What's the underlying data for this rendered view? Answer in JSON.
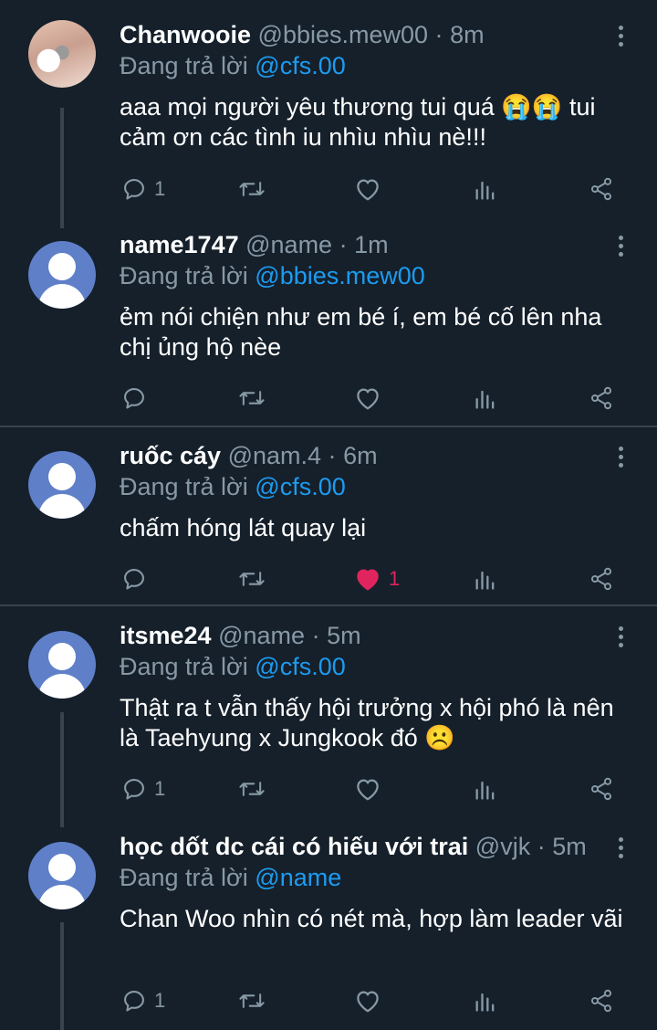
{
  "tweets": [
    {
      "name": "Chanwooie",
      "handle": "@bbies.mew00",
      "time": "8m",
      "reply_prefix": "Đang trả lời",
      "reply_to": "@cfs.00",
      "text": "aaa mọi người yêu thương tui quá 😭😭 tui cảm ơn các tình iu nhìu nhìu nè!!!",
      "reply_count": "1",
      "like_count": "",
      "liked": false
    },
    {
      "name": "name1747",
      "handle": "@name",
      "time": "1m",
      "reply_prefix": "Đang trả lời",
      "reply_to": "@bbies.mew00",
      "text": "ẻm nói chiện như em bé í, em bé cố lên nha chị ủng hộ nèe",
      "reply_count": "",
      "like_count": "",
      "liked": false
    },
    {
      "name": "ruốc cáy",
      "handle": "@nam.4",
      "time": "6m",
      "reply_prefix": "Đang trả lời",
      "reply_to": "@cfs.00",
      "text": "chấm hóng lát quay lại",
      "reply_count": "",
      "like_count": "1",
      "liked": true
    },
    {
      "name": "itsme24",
      "handle": "@name",
      "time": "5m",
      "reply_prefix": "Đang trả lời",
      "reply_to": "@cfs.00",
      "text": "Thật ra t vẫn thấy hội trưởng x hội phó là nên là Taehyung x Jungkook đó ☹️",
      "reply_count": "1",
      "like_count": "",
      "liked": false
    },
    {
      "name": "học dốt dc cái có hiếu với trai",
      "handle": "@vjk",
      "time": "5m",
      "reply_prefix": "Đang trả lời",
      "reply_to": "@name",
      "text": "Chan Woo nhìn có nét mà, hợp làm leader vãi",
      "reply_count": "1",
      "like_count": "",
      "liked": false
    }
  ],
  "separator": "·",
  "colors": {
    "background": "#15202b",
    "secondary_text": "#8899a6",
    "mention": "#1d9bf0",
    "like": "#e0245e",
    "divider": "#38444d"
  },
  "icons": [
    "reply-icon",
    "retweet-icon",
    "like-icon",
    "analytics-icon",
    "share-icon",
    "more-icon"
  ]
}
